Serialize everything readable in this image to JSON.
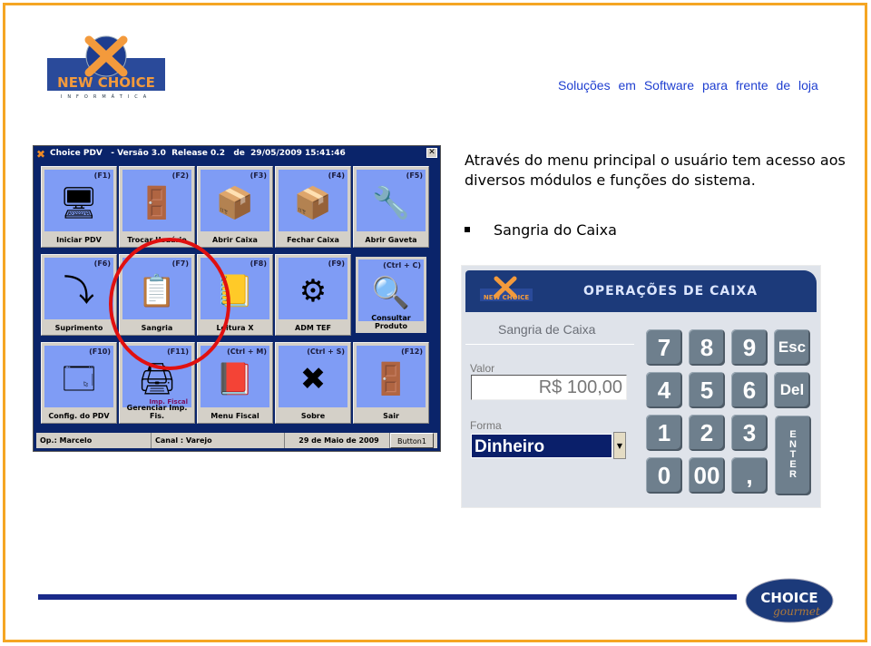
{
  "slide": {
    "tagline": "Soluções em Software para frente de loja",
    "logo_text": "NEW CHOICE",
    "logo_sub": "INFORMÁTICA",
    "footer_logo": "CHOICE gourmet",
    "border_color": "#f5a623",
    "accent": "#1a2a8a"
  },
  "text": {
    "paragraph": "Através do menu principal o usuário tem acesso aos diversos módulos e funções do sistema.",
    "bullet": "Sangria do Caixa"
  },
  "pdv": {
    "title": "Choice PDV   - Versão 3.0  Release 0.2   de  29/05/2009 15:41:46",
    "close": "✕",
    "tiles": [
      {
        "key": "(F1)",
        "label": "Iniciar PDV",
        "icon": "computer-icon",
        "glyph": "🖥"
      },
      {
        "key": "(F2)",
        "label": "Trocar Usuário",
        "icon": "exit-door-users-icon",
        "glyph": "🚪"
      },
      {
        "key": "(F3)",
        "label": "Abrir Caixa",
        "icon": "open-box-icon",
        "glyph": "📦"
      },
      {
        "key": "(F4)",
        "label": "Fechar Caixa",
        "icon": "closed-box-icon",
        "glyph": "📦"
      },
      {
        "key": "(F5)",
        "label": "Abrir Gaveta",
        "icon": "wrench-icon",
        "glyph": "🔧"
      },
      {
        "key": "(F6)",
        "label": "Suprimento",
        "icon": "green-arrow-icon",
        "glyph": "⤵"
      },
      {
        "key": "(F7)",
        "label": "Sangria",
        "icon": "clipboard-icon",
        "glyph": "📋"
      },
      {
        "key": "(F8)",
        "label": "Leitura X",
        "icon": "notebook-pencil-icon",
        "glyph": "📒"
      },
      {
        "key": "(F9)",
        "label": "ADM TEF",
        "icon": "gear-icon",
        "glyph": "⚙"
      },
      {
        "key": "(Ctrl + C)",
        "label": "Consultar Produto",
        "icon": "magnifier-icon",
        "glyph": "🔍",
        "selected": true
      },
      {
        "key": "(F10)",
        "label": "Config. do PDV",
        "icon": "window-tools-icon",
        "glyph": "🗔"
      },
      {
        "key": "(F11)",
        "label": "Gerenciar Imp. Fis.",
        "icon": "printer-icon",
        "glyph": "🖨",
        "sub": "Imp. Fiscal"
      },
      {
        "key": "(Ctrl + M)",
        "label": "Menu Fiscal",
        "icon": "red-notebook-icon",
        "glyph": "📕"
      },
      {
        "key": "(Ctrl + S)",
        "label": "Sobre",
        "icon": "choice-x-logo-icon",
        "glyph": "✖"
      },
      {
        "key": "(F12)",
        "label": "Sair",
        "icon": "exit-door-icon",
        "glyph": "🚪"
      }
    ],
    "status": {
      "operator": "Op.: Marcelo",
      "channel": "Canal : Varejo",
      "date": "29 de Maio de 2009",
      "button": "Button1"
    }
  },
  "ops": {
    "title": "OPERAÇÕES DE CAIXA",
    "subtitle": "Sangria de Caixa",
    "valor_label": "Valor",
    "valor": "R$ 100,00",
    "forma_label": "Forma",
    "forma": "Dinheiro",
    "keys": [
      "7",
      "8",
      "9",
      "Esc",
      "4",
      "5",
      "6",
      "Del",
      "1",
      "2",
      "3",
      "0",
      "00",
      ","
    ],
    "enter": "E\nN\nT\nE\nR"
  }
}
